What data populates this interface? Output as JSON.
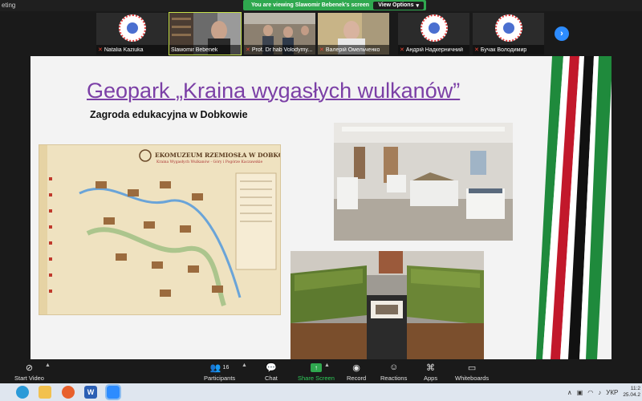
{
  "window": {
    "title": "eting"
  },
  "banner": {
    "viewing_text": "You are viewing Slawomir Bebenek's screen",
    "view_options_label": "View Options"
  },
  "participants": [
    {
      "name": "Natalia Kaziuka",
      "muted": true,
      "kind": "logo"
    },
    {
      "name": "Slawomir Bebenek",
      "muted": false,
      "kind": "video"
    },
    {
      "name": "Prof. Dr hab Volodymy...",
      "muted": true,
      "kind": "video"
    },
    {
      "name": "Валерій Омельченко",
      "muted": true,
      "kind": "video"
    },
    {
      "name": "Андрій Надкерничний",
      "muted": true,
      "kind": "logo"
    },
    {
      "name": "Бучак Володимир",
      "muted": true,
      "kind": "logo"
    }
  ],
  "slide": {
    "title": "Geopark „Kraina wygasłych wulkanów”",
    "subtitle": "Zagroda edukacyjna w Dobkowie",
    "map_heading": "EKOMUZEUM RZEMIOSŁA W DOBKOWIE",
    "map_subheading": "Kraina Wygasłych Wulkanów - Góry i Pogórze Kaczawskie",
    "stripe_colors": [
      "#1f8a3c",
      "#c2182b",
      "#ffffff",
      "#111111"
    ]
  },
  "toolbar": {
    "start_video": "Start Video",
    "participants": "Participants",
    "participants_count": "16",
    "chat": "Chat",
    "share_screen": "Share Screen",
    "record": "Record",
    "reactions": "Reactions",
    "apps": "Apps",
    "whiteboards": "Whiteboards"
  },
  "taskbar": {
    "language": "УКР",
    "time": "11:2",
    "date": "25.04.2"
  }
}
